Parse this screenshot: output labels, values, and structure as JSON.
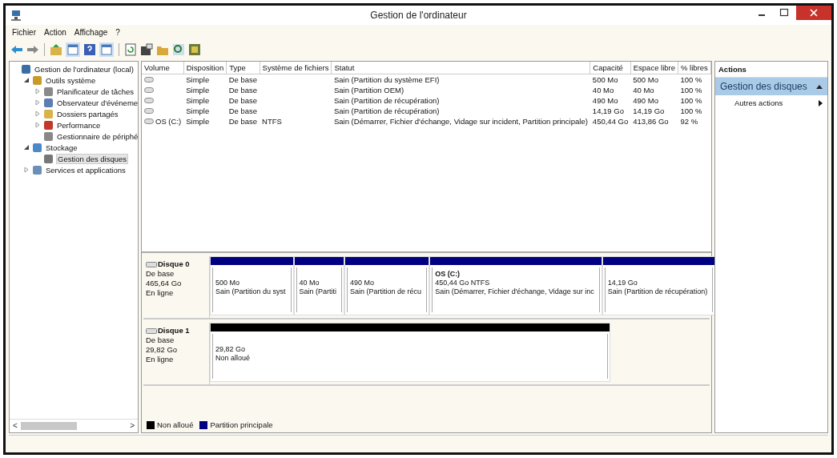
{
  "window": {
    "title": "Gestion de l'ordinateur"
  },
  "menu": [
    "Fichier",
    "Action",
    "Affichage",
    "?"
  ],
  "tree": [
    {
      "label": "Gestion de l'ordinateur (local)",
      "selected": false,
      "children": [
        {
          "label": "Outils système",
          "expanded": true,
          "selected": false,
          "children": [
            {
              "label": "Planificateur de tâches",
              "expanded": false,
              "selected": false
            },
            {
              "label": "Observateur d'événeme",
              "expanded": false,
              "selected": false
            },
            {
              "label": "Dossiers partagés",
              "expanded": false,
              "selected": false
            },
            {
              "label": "Performance",
              "expanded": false,
              "selected": false
            },
            {
              "label": "Gestionnaire de périphé",
              "selected": false
            }
          ]
        },
        {
          "label": "Stockage",
          "expanded": true,
          "selected": false,
          "children": [
            {
              "label": "Gestion des disques",
              "selected": true
            }
          ]
        },
        {
          "label": "Services et applications",
          "expanded": false,
          "selected": false
        }
      ]
    }
  ],
  "scrollbar": {
    "left": "<",
    "right": ">"
  },
  "table": {
    "columns": [
      "Volume",
      "Disposition",
      "Type",
      "Système de fichiers",
      "Statut",
      "Capacité",
      "Espace libre",
      "% libres"
    ],
    "rows": [
      [
        "",
        "Simple",
        "De base",
        "",
        "Sain (Partition du système EFI)",
        "500 Mo",
        "500 Mo",
        "100 %"
      ],
      [
        "",
        "Simple",
        "De base",
        "",
        "Sain (Partition OEM)",
        "40 Mo",
        "40 Mo",
        "100 %"
      ],
      [
        "",
        "Simple",
        "De base",
        "",
        "Sain (Partition de récupération)",
        "490 Mo",
        "490 Mo",
        "100 %"
      ],
      [
        "",
        "Simple",
        "De base",
        "",
        "Sain (Partition de récupération)",
        "14,19 Go",
        "14,19 Go",
        "100 %"
      ],
      [
        "OS (C:)",
        "Simple",
        "De base",
        "NTFS",
        "Sain (Démarrer, Fichier d'échange, Vidage sur incident, Partition principale)",
        "450,44 Go",
        "413,86 Go",
        "92 %"
      ]
    ]
  },
  "disks": [
    {
      "name": "Disque 0",
      "type": "De base",
      "size": "465,64 Go",
      "status": "En ligne",
      "partitions": [
        {
          "kind": "primary",
          "lines": [
            "500 Mo",
            "Sain (Partition du syst"
          ]
        },
        {
          "kind": "primary",
          "lines": [
            "40 Mo",
            "Sain (Partiti"
          ]
        },
        {
          "kind": "primary",
          "lines": [
            "490 Mo",
            "Sain (Partition de récu"
          ]
        },
        {
          "kind": "primary",
          "title": "OS  (C:)",
          "lines": [
            "450,44 Go NTFS",
            "Sain (Démarrer, Fichier d'échange, Vidage sur inc"
          ]
        },
        {
          "kind": "primary",
          "lines": [
            "14,19 Go",
            "Sain (Partition de récupération)"
          ]
        }
      ]
    },
    {
      "name": "Disque 1",
      "type": "De base",
      "size": "29,82 Go",
      "status": "En ligne",
      "partitions": [
        {
          "kind": "unallocated",
          "lines": [
            "29,82 Go",
            "Non alloué"
          ]
        }
      ]
    }
  ],
  "legend": [
    {
      "label": "Non alloué",
      "color": "#000000"
    },
    {
      "label": "Partition principale",
      "color": "#000080"
    }
  ],
  "actions": {
    "header": "Actions",
    "section": "Gestion des disques",
    "items": [
      "Autres actions"
    ]
  }
}
